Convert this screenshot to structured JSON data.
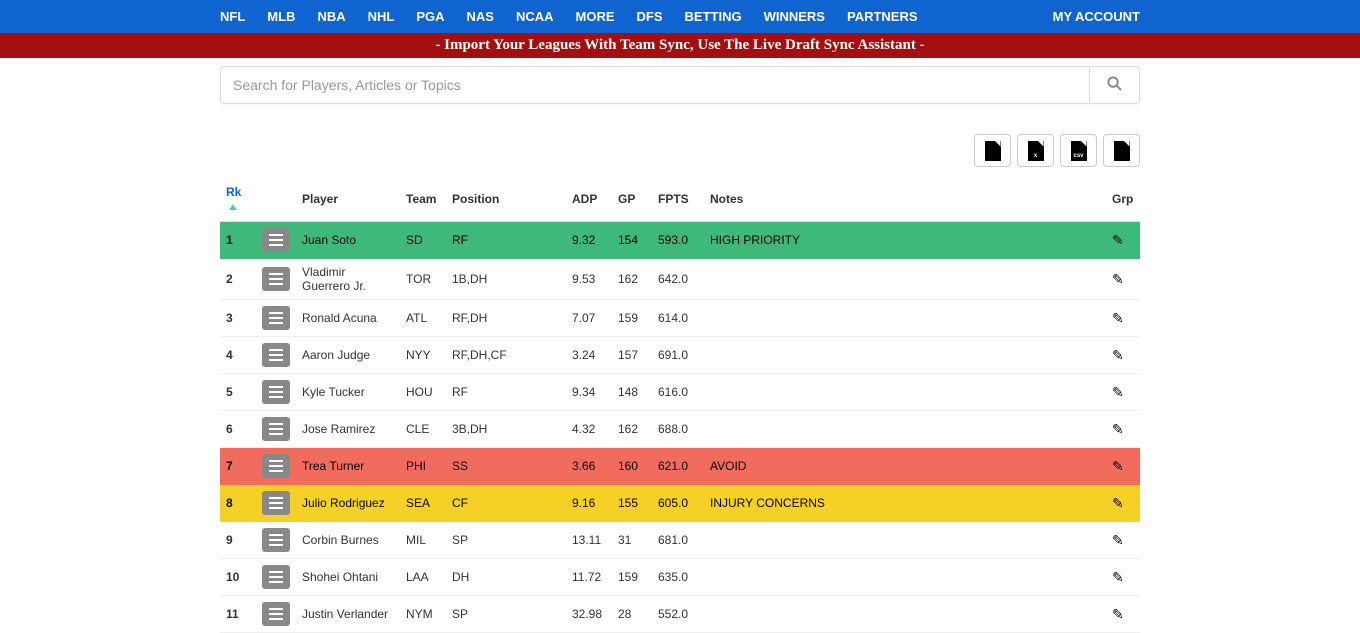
{
  "nav": {
    "items": [
      "NFL",
      "MLB",
      "NBA",
      "NHL",
      "PGA",
      "NAS",
      "NCAA",
      "MORE",
      "DFS",
      "BETTING",
      "WINNERS",
      "PARTNERS"
    ],
    "account": "MY ACCOUNT"
  },
  "banner": "- Import Your Leagues With Team Sync, Use The Live Draft Sync Assistant -",
  "search": {
    "placeholder": "Search for Players, Articles or Topics"
  },
  "export": {
    "doc": "",
    "xls": "x",
    "csv": "csv",
    "pdf": ""
  },
  "columns": {
    "rk": "Rk",
    "player": "Player",
    "team": "Team",
    "position": "Position",
    "adp": "ADP",
    "gp": "GP",
    "fpts": "FPTS",
    "notes": "Notes",
    "grp": "Grp"
  },
  "rows": [
    {
      "rk": "1",
      "player": "Juan Soto",
      "team": "SD",
      "position": "RF",
      "adp": "9.32",
      "gp": "154",
      "fpts": "593.0",
      "notes": "HIGH PRIORITY",
      "color": "green"
    },
    {
      "rk": "2",
      "player": "Vladimir Guerrero Jr.",
      "team": "TOR",
      "position": "1B,DH",
      "adp": "9.53",
      "gp": "162",
      "fpts": "642.0",
      "notes": "",
      "color": ""
    },
    {
      "rk": "3",
      "player": "Ronald Acuna",
      "team": "ATL",
      "position": "RF,DH",
      "adp": "7.07",
      "gp": "159",
      "fpts": "614.0",
      "notes": "",
      "color": ""
    },
    {
      "rk": "4",
      "player": "Aaron Judge",
      "team": "NYY",
      "position": "RF,DH,CF",
      "adp": "3.24",
      "gp": "157",
      "fpts": "691.0",
      "notes": "",
      "color": ""
    },
    {
      "rk": "5",
      "player": "Kyle Tucker",
      "team": "HOU",
      "position": "RF",
      "adp": "9.34",
      "gp": "148",
      "fpts": "616.0",
      "notes": "",
      "color": ""
    },
    {
      "rk": "6",
      "player": "Jose Ramirez",
      "team": "CLE",
      "position": "3B,DH",
      "adp": "4.32",
      "gp": "162",
      "fpts": "688.0",
      "notes": "",
      "color": ""
    },
    {
      "rk": "7",
      "player": "Trea Turner",
      "team": "PHI",
      "position": "SS",
      "adp": "3.66",
      "gp": "160",
      "fpts": "621.0",
      "notes": "AVOID",
      "color": "red"
    },
    {
      "rk": "8",
      "player": "Julio Rodriguez",
      "team": "SEA",
      "position": "CF",
      "adp": "9.16",
      "gp": "155",
      "fpts": "605.0",
      "notes": "INJURY CONCERNS",
      "color": "yellow"
    },
    {
      "rk": "9",
      "player": "Corbin Burnes",
      "team": "MIL",
      "position": "SP",
      "adp": "13.11",
      "gp": "31",
      "fpts": "681.0",
      "notes": "",
      "color": ""
    },
    {
      "rk": "10",
      "player": "Shohei Ohtani",
      "team": "LAA",
      "position": "DH",
      "adp": "11.72",
      "gp": "159",
      "fpts": "635.0",
      "notes": "",
      "color": ""
    },
    {
      "rk": "11",
      "player": "Justin Verlander",
      "team": "NYM",
      "position": "SP",
      "adp": "32.98",
      "gp": "28",
      "fpts": "552.0",
      "notes": "",
      "color": ""
    }
  ]
}
